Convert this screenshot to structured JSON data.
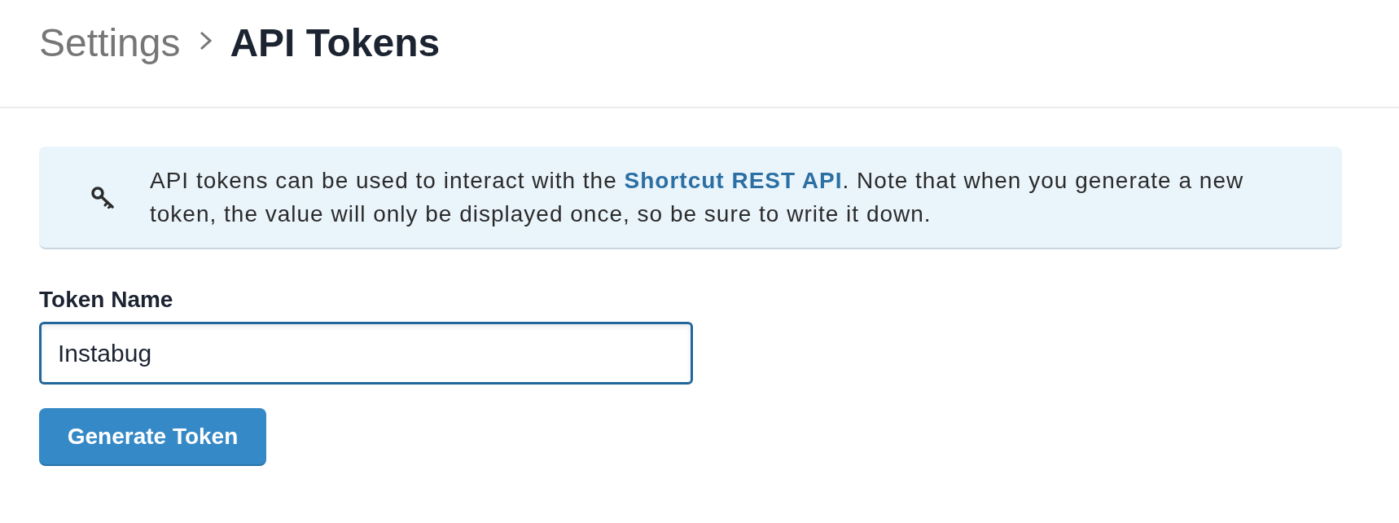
{
  "breadcrumb": {
    "parent": "Settings",
    "current": "API Tokens"
  },
  "notice": {
    "text_before": "API tokens can be used to interact with the ",
    "link": "Shortcut REST API",
    "text_after": ". Note that when you generate a new token, the value will only be displayed once, so be sure to write it down."
  },
  "form": {
    "label": "Token Name",
    "field": {
      "value": "Instabug",
      "focused": true
    },
    "button": "Generate Token"
  }
}
